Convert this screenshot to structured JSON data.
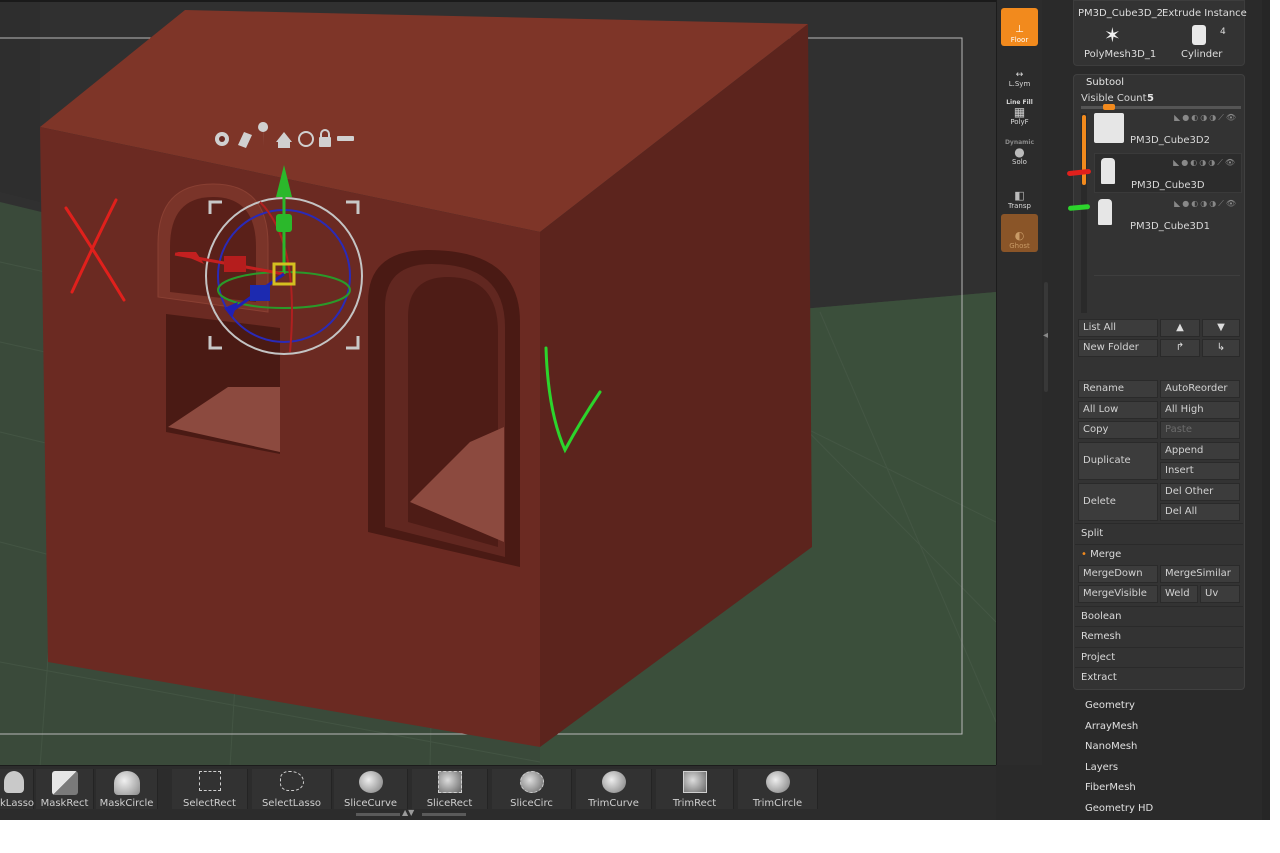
{
  "shelf": {
    "floor": "Floor",
    "lsym": "L.Sym",
    "linefill_top": "Line Fill",
    "polyf": "PolyF",
    "dynamic_top": "Dynamic",
    "solo": "Solo",
    "transp": "Transp",
    "ghost": "Ghost"
  },
  "tool_thumbs": {
    "item1": "PM3D_Cube3D_2",
    "item2": "Extrude Instance",
    "item3": "PolyMesh3D_1",
    "item4": "Cylinder",
    "count": "4"
  },
  "subtool": {
    "title": "Subtool",
    "visible_count_label": "Visible Count",
    "visible_count": "5",
    "items": [
      {
        "name": "PM3D_Cube3D2"
      },
      {
        "name": "PM3D_Cube3D"
      },
      {
        "name": "PM3D_Cube3D1"
      }
    ],
    "list_all": "List All",
    "new_folder": "New Folder",
    "rename": "Rename",
    "auto_reorder": "AutoReorder",
    "all_low": "All Low",
    "all_high": "All High",
    "copy": "Copy",
    "paste": "Paste",
    "duplicate": "Duplicate",
    "append": "Append",
    "insert": "Insert",
    "delete": "Delete",
    "del_other": "Del Other",
    "del_all": "Del All",
    "split": "Split",
    "merge": "Merge",
    "merge_down": "MergeDown",
    "merge_similar": "MergeSimilar",
    "merge_visible": "MergeVisible",
    "weld": "Weld",
    "uv": "Uv",
    "boolean": "Boolean",
    "remesh": "Remesh",
    "project": "Project",
    "extract": "Extract"
  },
  "menus": [
    "Geometry",
    "ArrayMesh",
    "NanoMesh",
    "Layers",
    "FiberMesh",
    "Geometry HD"
  ],
  "bottom_tools": [
    "kLasso",
    "MaskRect",
    "MaskCircle",
    "SelectRect",
    "SelectLasso",
    "SliceCurve",
    "SliceRect",
    "SliceCirc",
    "TrimCurve",
    "TrimRect",
    "TrimCircle"
  ],
  "colors": {
    "accent": "#f28a1d",
    "mesh": "#6b2a22",
    "annotation_red": "#e0201c",
    "annotation_green": "#2cd42c"
  }
}
